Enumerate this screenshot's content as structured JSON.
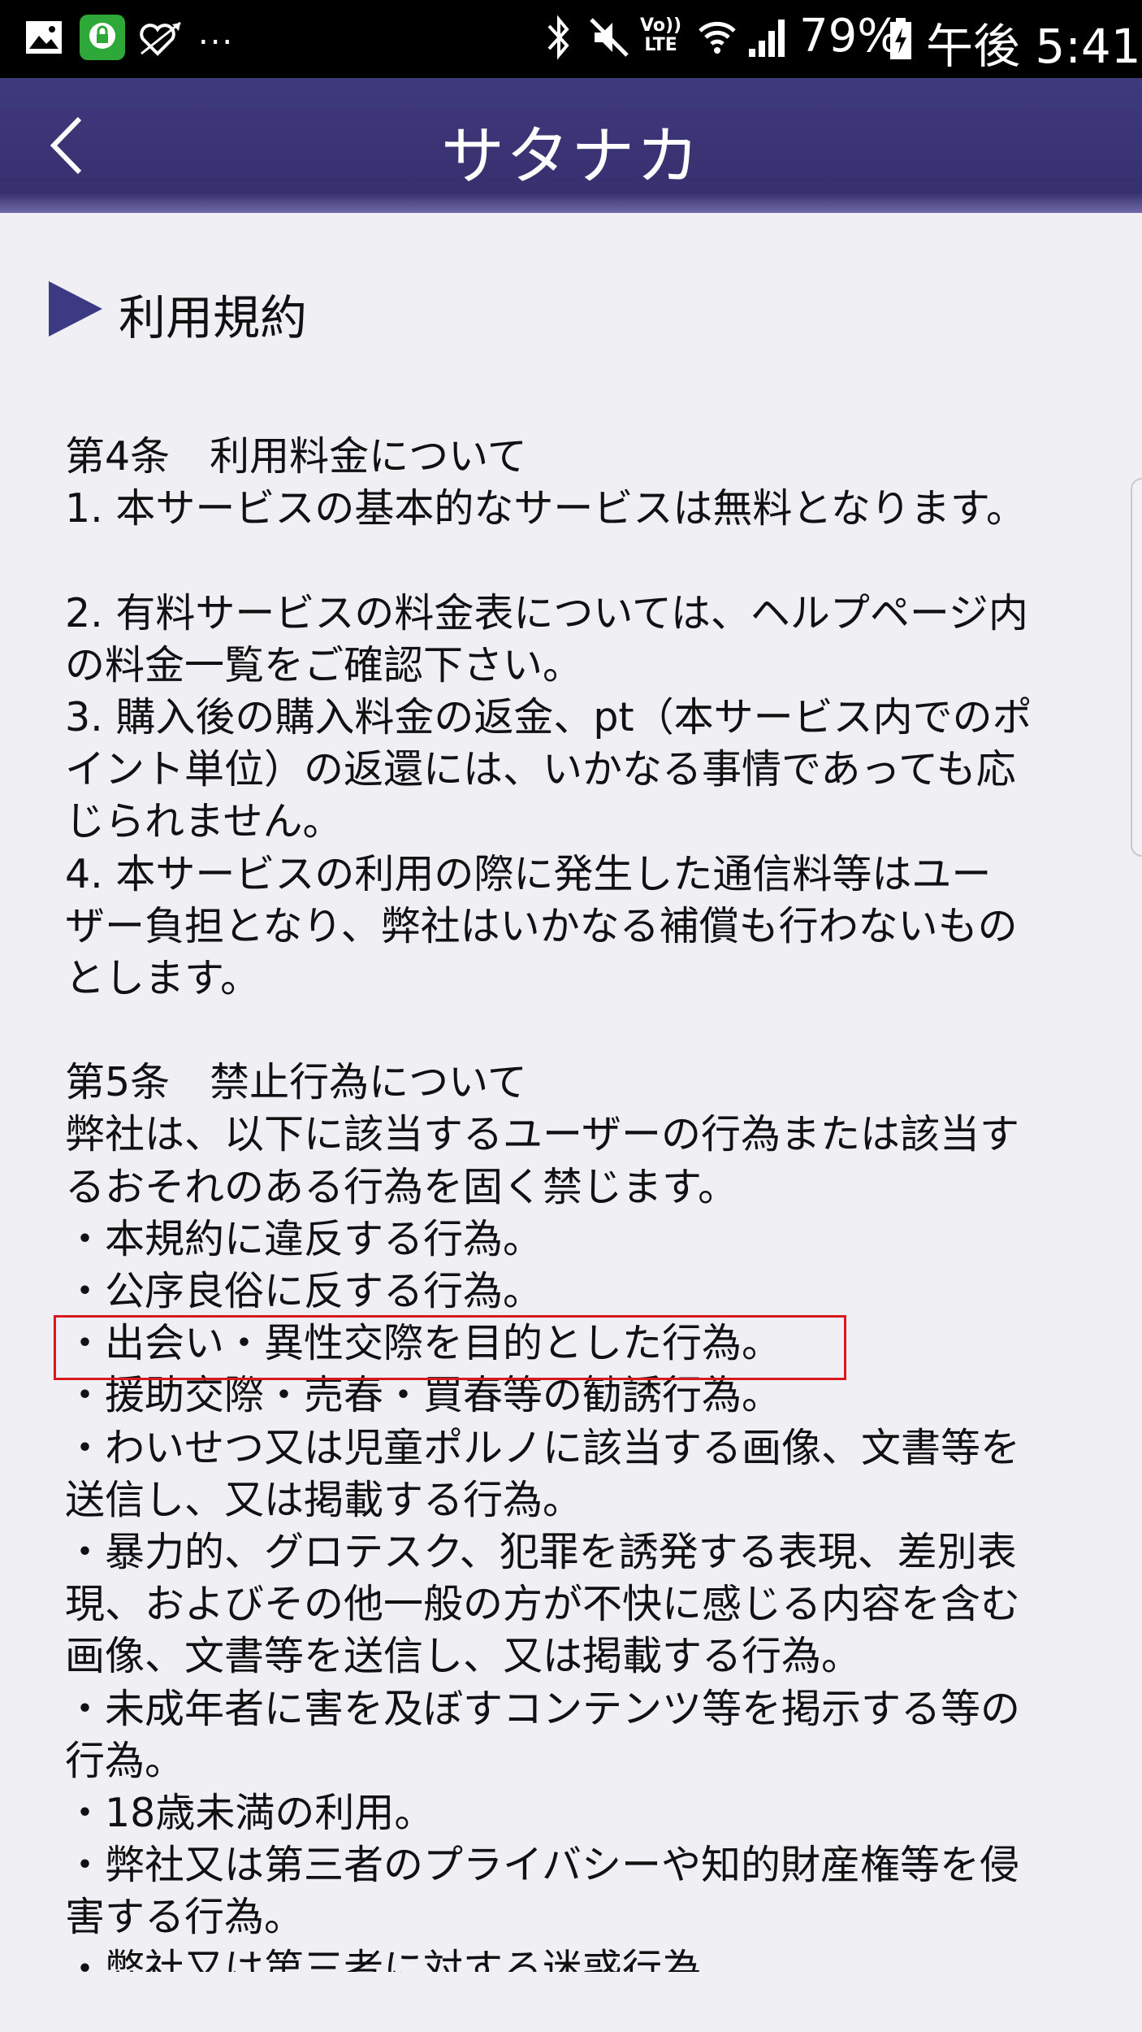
{
  "status_bar": {
    "left_icons": [
      "gallery-icon",
      "lock-app-icon",
      "heart-arrow-icon"
    ],
    "more": "...",
    "volte_line1": "Vo))",
    "volte_line2": "LTE",
    "battery_percent": "79%",
    "time": "午後 5:41"
  },
  "header": {
    "title": "サタナカ"
  },
  "section": {
    "title": "利用規約"
  },
  "terms": {
    "lines": [
      "第4条　利用料金について",
      "1. 本サービスの基本的なサービスは無料となります。",
      "",
      "2. 有料サービスの料金表については、ヘルプページ内",
      "の料金一覧をご確認下さい。",
      "3. 購入後の購入料金の返金、pt（本サービス内でのポ",
      "イント単位）の返還には、いかなる事情であっても応",
      "じられません。",
      "4. 本サービスの利用の際に発生した通信料等はユー",
      "ザー負担となり、弊社はいかなる補償も行わないもの",
      "とします。",
      "",
      "第5条　禁止行為について",
      "弊社は、以下に該当するユーザーの行為または該当す",
      "るおそれのある行為を固く禁じます。",
      "・本規約に違反する行為。",
      "・公序良俗に反する行為。",
      "・出会い・異性交際を目的とした行為。",
      "・援助交際・売春・買春等の勧誘行為。",
      "・わいせつ又は児童ポルノに該当する画像、文書等を",
      "送信し、又は掲載する行為。",
      "・暴力的、グロテスク、犯罪を誘発する表現、差別表",
      "現、およびその他一般の方が不快に感じる内容を含む",
      "画像、文書等を送信し、又は掲載する行為。",
      "・未成年者に害を及ぼすコンテンツ等を掲示する等の",
      "行為。",
      "・18歳未満の利用。",
      "・弊社又は第三者のプライバシーや知的財産権等を侵",
      "害する行為。",
      "・弊社又は第三者に対する迷惑行為"
    ]
  },
  "colors": {
    "header": "#3f3a7e",
    "accent_triangle": "#3c3a83",
    "highlight": "#d8191d",
    "background": "#efeff4"
  }
}
